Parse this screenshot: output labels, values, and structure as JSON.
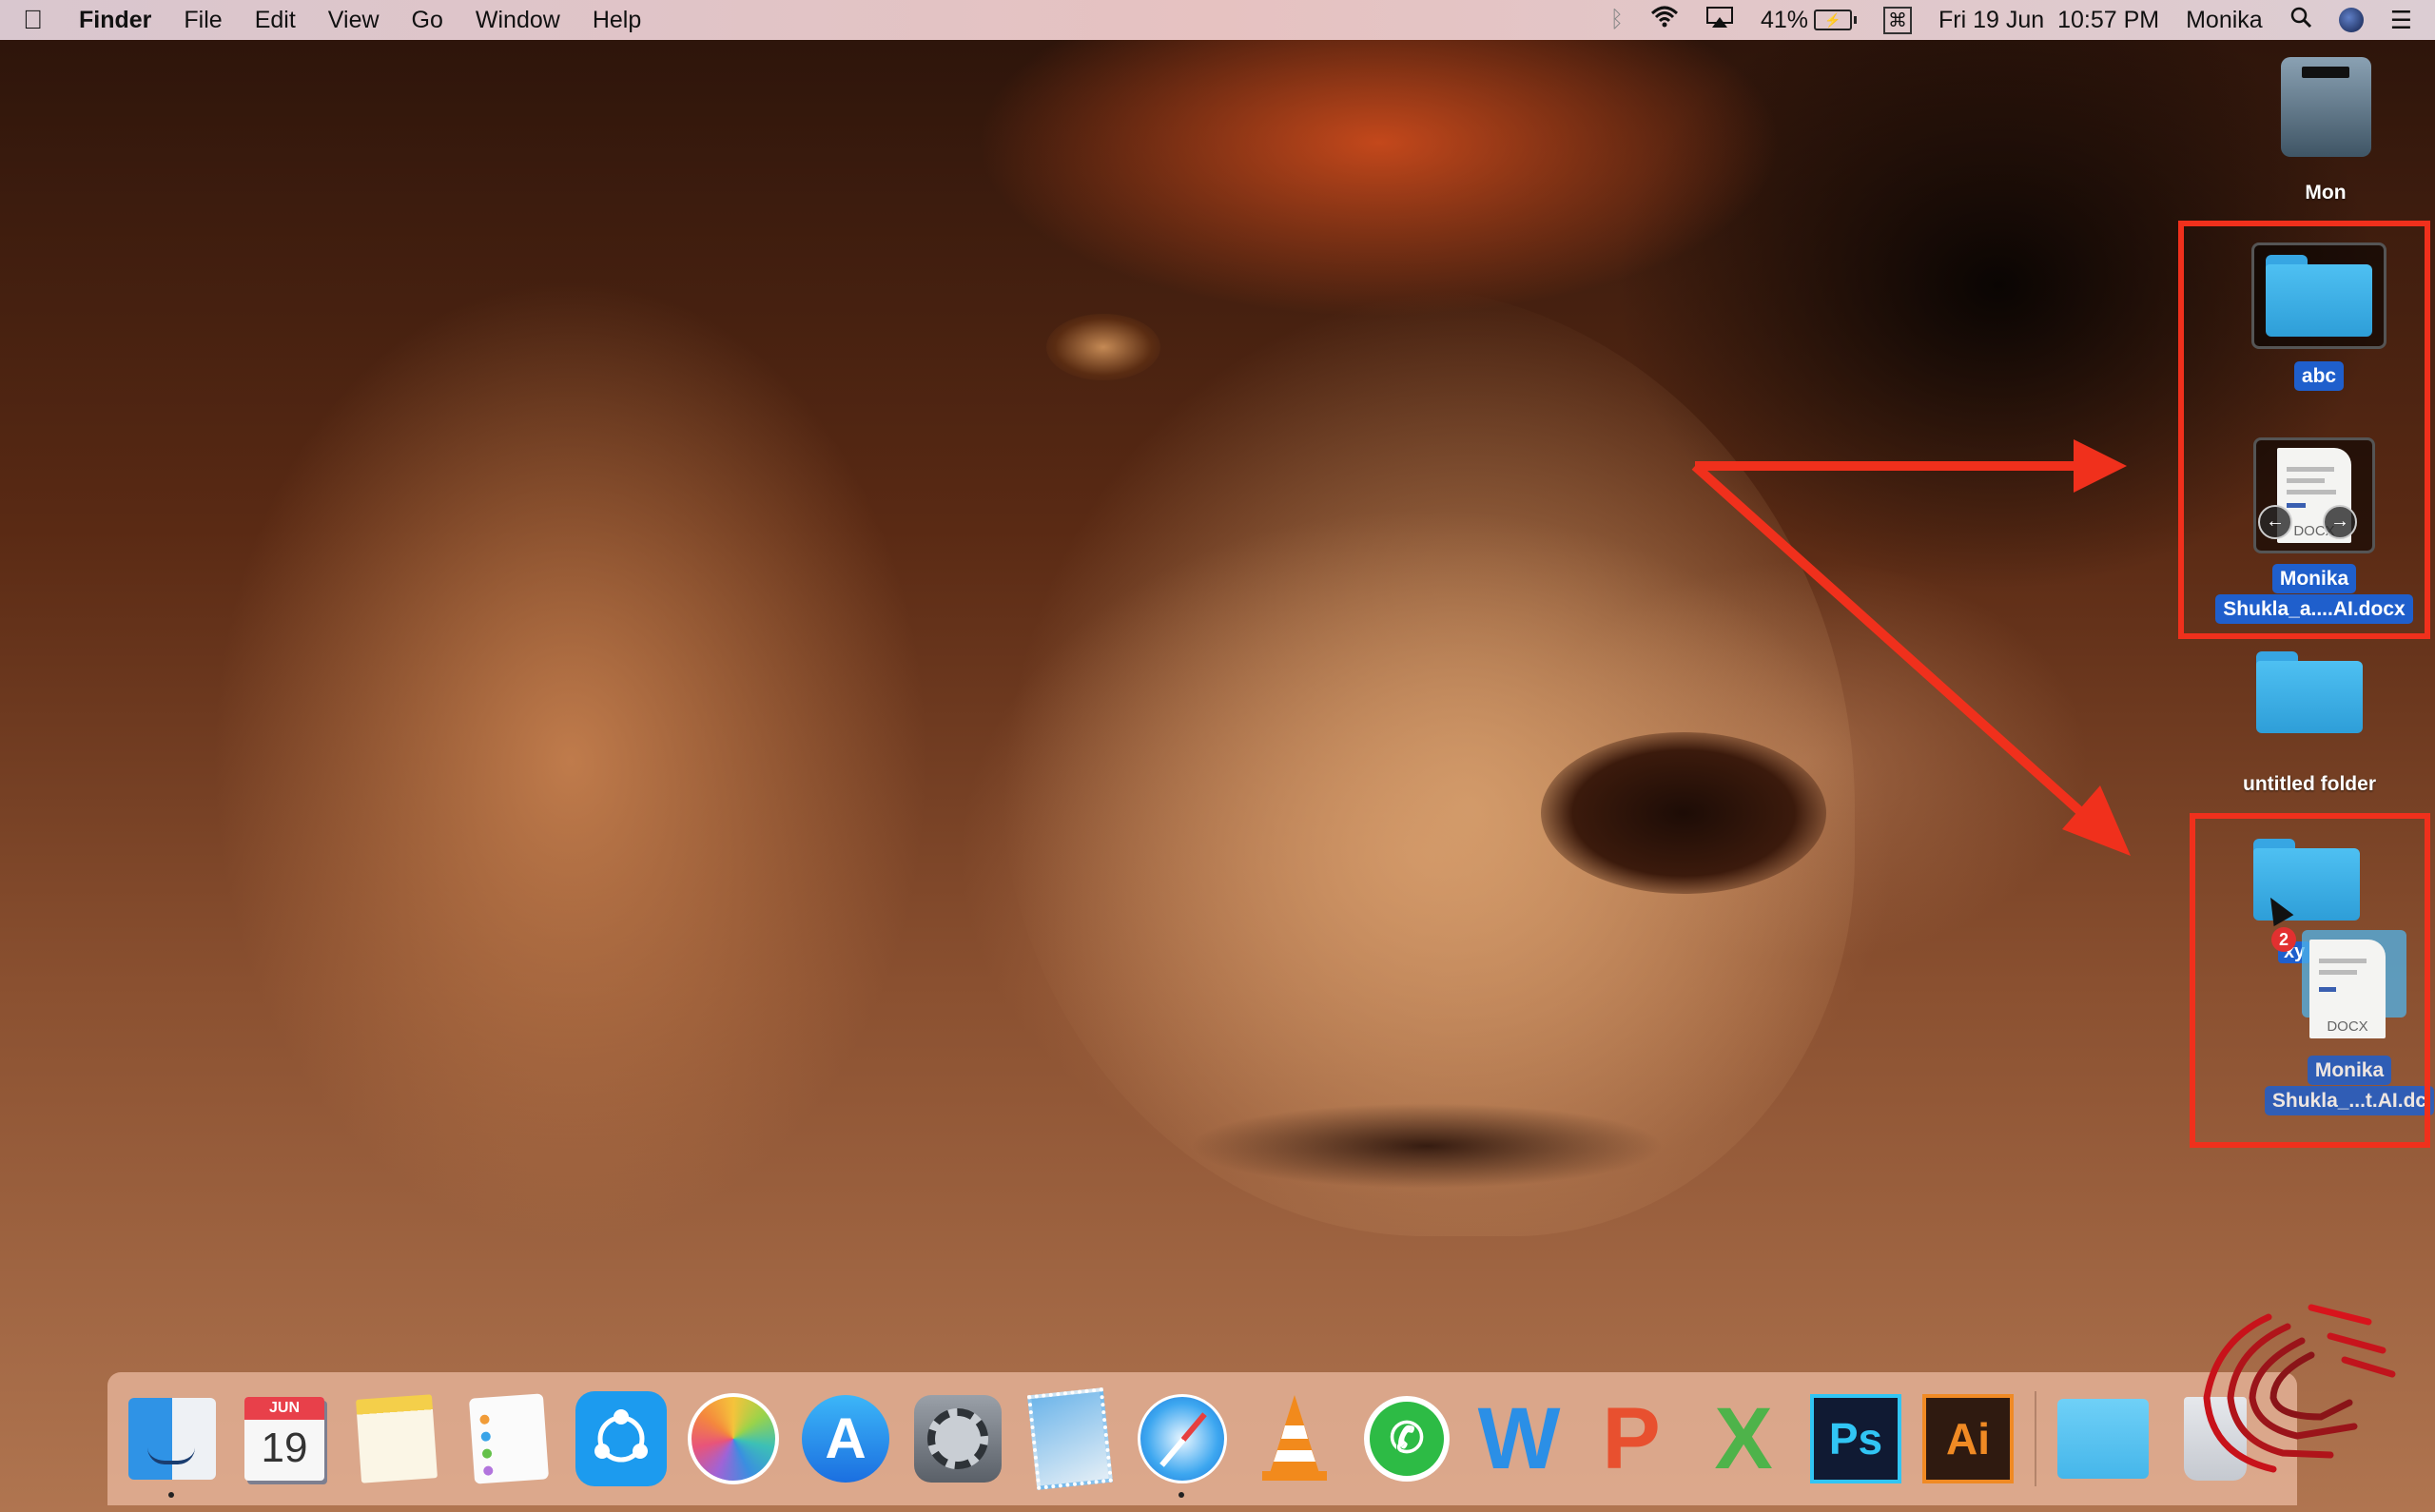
{
  "menubar": {
    "apple_icon": "apple-logo-icon",
    "app_name": "Finder",
    "menus": [
      "File",
      "Edit",
      "View",
      "Go",
      "Window",
      "Help"
    ],
    "status": {
      "bluetooth_icon": "bluetooth-icon",
      "wifi_icon": "wifi-icon",
      "airplay_icon": "airplay-icon",
      "battery_percent": "41%",
      "battery_icon": "battery-charging-icon",
      "keyboard_icon": "input-source-icon",
      "datetime": "Fri 19 Jun  10:57 PM",
      "user": "Monika",
      "spotlight_icon": "search-icon",
      "siri_icon": "siri-icon",
      "notification_icon": "notification-center-icon"
    }
  },
  "desktop": {
    "icons": [
      {
        "label": "Mon",
        "type": "hard-drive",
        "selected": false
      },
      {
        "label": "abc",
        "type": "folder",
        "selected": true
      },
      {
        "label_line1": "Monika",
        "label_line2": "Shukla_a....AI.docx",
        "type": "docx",
        "selected": true,
        "preview_text": "DOCX"
      },
      {
        "label": "untitled folder",
        "type": "folder",
        "selected": false
      },
      {
        "label": "xy",
        "type": "folder",
        "selected": true,
        "drop_target": true
      }
    ],
    "drag": {
      "count_badge": "2",
      "ghost_label_line1": "Monika",
      "ghost_label_line2": "Shukla_...t.AI.dc",
      "ghost_doc_text": "DOCX"
    }
  },
  "annotations": {
    "color": "#f0301c",
    "description": "Red arrows pointing from selection to drop target"
  },
  "dock": {
    "apps": [
      {
        "name": "Finder",
        "running": true
      },
      {
        "name": "Calendar",
        "month": "JUN",
        "day": "19"
      },
      {
        "name": "Notes"
      },
      {
        "name": "Reminders"
      },
      {
        "name": "SHAREit"
      },
      {
        "name": "Photos"
      },
      {
        "name": "App Store"
      },
      {
        "name": "System Preferences"
      },
      {
        "name": "Mail"
      },
      {
        "name": "Safari",
        "running": true
      },
      {
        "name": "VLC"
      },
      {
        "name": "WhatsApp"
      },
      {
        "name": "Word",
        "glyph": "W"
      },
      {
        "name": "PowerPoint",
        "glyph": "P"
      },
      {
        "name": "Excel",
        "glyph": "X"
      },
      {
        "name": "Photoshop",
        "glyph": "Ps"
      },
      {
        "name": "Illustrator",
        "glyph": "Ai"
      },
      {
        "name": "Downloads Folder"
      },
      {
        "name": "Trash"
      }
    ]
  }
}
